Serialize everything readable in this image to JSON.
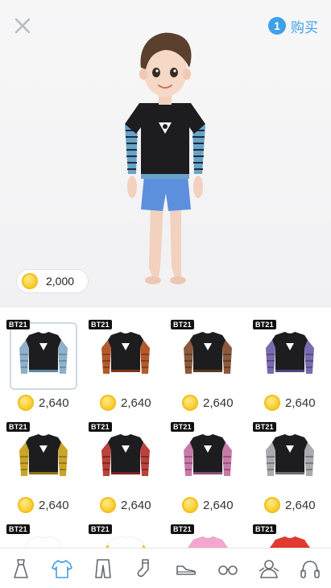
{
  "header": {
    "close_icon": "close-icon",
    "buy_count": "1",
    "buy_label": "购买",
    "accent_color": "#3ea0e8"
  },
  "wallet": {
    "amount": "2,000",
    "icon": "coin-icon"
  },
  "items": [
    {
      "badge": "BT21",
      "price": "2,640",
      "sleeve": "#8fb0c8",
      "sleeve2": "#5f86a3",
      "selected": true
    },
    {
      "badge": "BT21",
      "price": "2,640",
      "sleeve": "#b35a2c",
      "sleeve2": "#7d3518"
    },
    {
      "badge": "BT21",
      "price": "2,640",
      "sleeve": "#8a5a3c",
      "sleeve2": "#5a3722"
    },
    {
      "badge": "BT21",
      "price": "2,640",
      "sleeve": "#7b6ab0",
      "sleeve2": "#4f427e"
    },
    {
      "badge": "BT21",
      "price": "2,640",
      "sleeve": "#c9a52a",
      "sleeve2": "#8b7114"
    },
    {
      "badge": "BT21",
      "price": "2,640",
      "sleeve": "#b8423c",
      "sleeve2": "#7a221f"
    },
    {
      "badge": "BT21",
      "price": "2,640",
      "sleeve": "#c77aa8",
      "sleeve2": "#8c4b74"
    },
    {
      "badge": "BT21",
      "price": "2,640",
      "sleeve": "#a9abae",
      "sleeve2": "#6c6e72"
    },
    {
      "badge": "BT21",
      "price": "",
      "sleeve": "#ffffff",
      "sleeve2": "#dddddd",
      "body": "#ffffff"
    },
    {
      "badge": "BT21",
      "price": "",
      "sleeve": "#f2c230",
      "sleeve2": "#d9a514",
      "body": "#ffffff"
    },
    {
      "badge": "BT21",
      "price": "",
      "sleeve": "#f4a6cf",
      "sleeve2": "#e487b6",
      "body": "#f4a6cf"
    },
    {
      "badge": "BT21",
      "price": "",
      "sleeve": "#e23a30",
      "sleeve2": "#b9241c",
      "body": "#e23a30"
    }
  ],
  "tabs": [
    {
      "name": "dress-icon",
      "active": false
    },
    {
      "name": "tshirt-icon",
      "active": true
    },
    {
      "name": "pants-icon",
      "active": false
    },
    {
      "name": "socks-icon",
      "active": false
    },
    {
      "name": "sneaker-icon",
      "active": false
    },
    {
      "name": "glasses-icon",
      "active": false
    },
    {
      "name": "costume-icon",
      "active": false
    },
    {
      "name": "headphones-icon",
      "active": false
    }
  ]
}
